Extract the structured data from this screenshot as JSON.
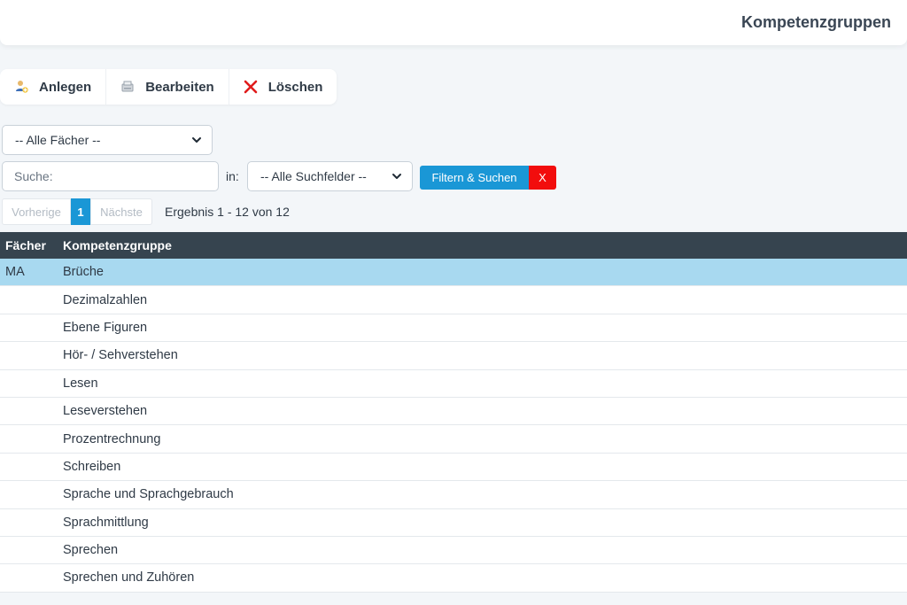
{
  "header": {
    "title": "Kompetenzgruppen"
  },
  "toolbar": {
    "create_label": "Anlegen",
    "edit_label": "Bearbeiten",
    "delete_label": "Löschen"
  },
  "filter": {
    "subject_select": "-- Alle Fächer --",
    "search_placeholder": "Suche:",
    "in_label": "in:",
    "field_select": "-- Alle Suchfelder --",
    "filter_button": "Filtern & Suchen",
    "clear_button": "X"
  },
  "pagination": {
    "prev_label": "Vorherige",
    "current_page": "1",
    "next_label": "Nächste",
    "result_text": "Ergebnis 1 - 12 von 12"
  },
  "table": {
    "columns": [
      "Fächer",
      "Kompetenzgruppe"
    ],
    "rows": [
      {
        "subject": "MA",
        "group": "Brüche",
        "selected": true
      },
      {
        "subject": "",
        "group": "Dezimalzahlen"
      },
      {
        "subject": "",
        "group": "Ebene Figuren"
      },
      {
        "subject": "",
        "group": "Hör- / Sehverstehen"
      },
      {
        "subject": "",
        "group": "Lesen"
      },
      {
        "subject": "",
        "group": "Leseverstehen"
      },
      {
        "subject": "",
        "group": "Prozentrechnung"
      },
      {
        "subject": "",
        "group": "Schreiben"
      },
      {
        "subject": "",
        "group": "Sprache und Sprachgebrauch"
      },
      {
        "subject": "",
        "group": "Sprachmittlung"
      },
      {
        "subject": "",
        "group": "Sprechen"
      },
      {
        "subject": "",
        "group": "Sprechen und Zuhören"
      }
    ]
  },
  "colors": {
    "accent": "#1a97d6",
    "danger": "#f20d0d",
    "header_bg": "#36444f",
    "selected_row": "#a8d9f0"
  },
  "icons": [
    "add-user-icon",
    "edit-icon",
    "delete-x-icon",
    "chevron-down-icon"
  ]
}
